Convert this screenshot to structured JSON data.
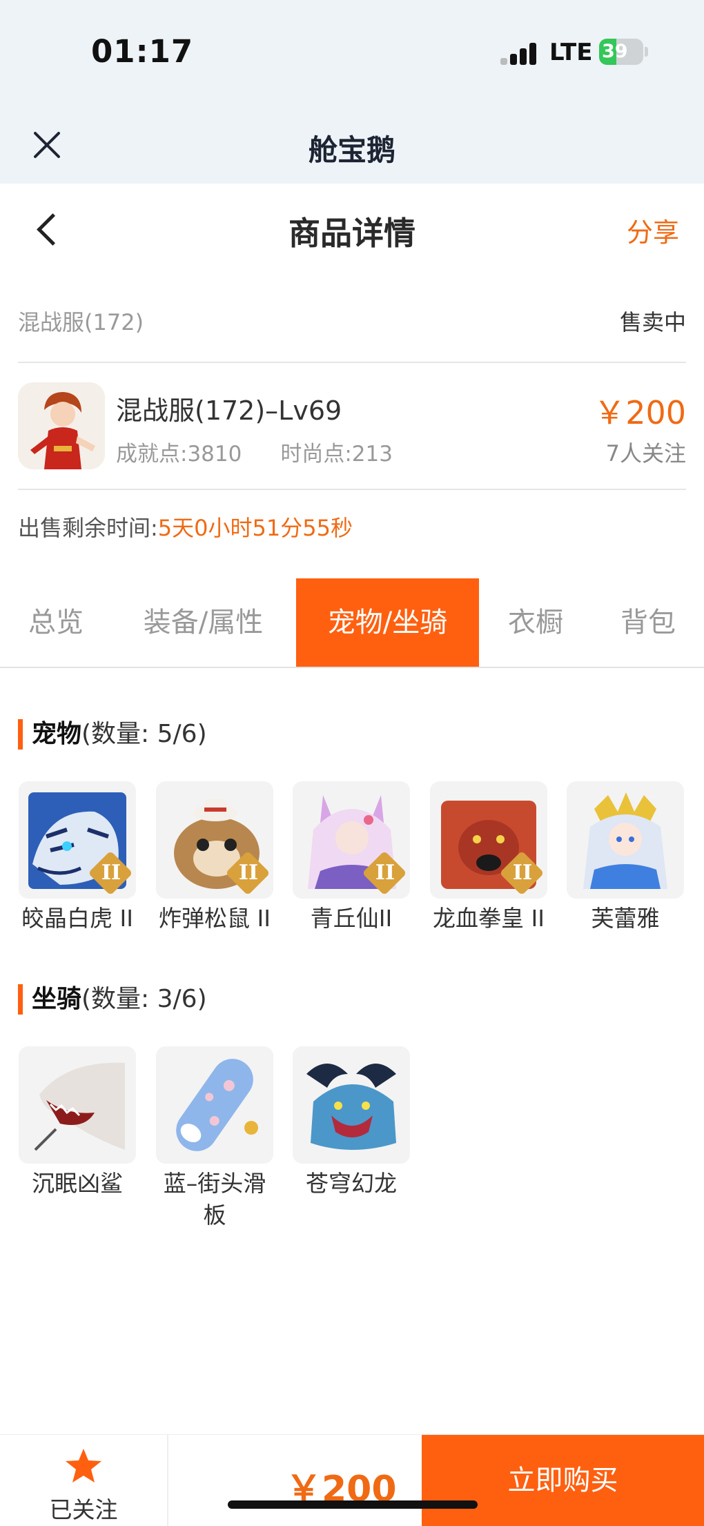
{
  "status_bar": {
    "time": "01:17",
    "network": "LTE",
    "battery": "39",
    "battery_level": 0.39
  },
  "app_bar": {
    "title": "舱宝鹅"
  },
  "nav": {
    "title": "商品详情",
    "share": "分享"
  },
  "listing": {
    "server": "混战服(172)",
    "status": "售卖中",
    "name": "混战服(172)–Lv69",
    "achievement": "成就点:3810",
    "fashion": "时尚点:213",
    "price": "￥200",
    "followers": "7人关注",
    "remaining_label": "出售剩余时间:",
    "remaining_value": "5天0小时51分55秒"
  },
  "tabs": [
    {
      "label": "总览",
      "active": false
    },
    {
      "label": "装备/属性",
      "active": false
    },
    {
      "label": "宠物/坐骑",
      "active": true
    },
    {
      "label": "衣橱",
      "active": false
    },
    {
      "label": "背包",
      "active": false
    }
  ],
  "pets": {
    "title": "宠物",
    "count": "(数量: 5/6)",
    "items": [
      {
        "name": "皎晶白虎 II",
        "badge": "II"
      },
      {
        "name": "炸弹松鼠 II",
        "badge": "II"
      },
      {
        "name": "青丘仙II",
        "badge": "II"
      },
      {
        "name": "龙血拳皇 II",
        "badge": "II"
      },
      {
        "name": "芙蕾雅",
        "badge": ""
      }
    ]
  },
  "mounts": {
    "title": "坐骑",
    "count": "(数量: 3/6)",
    "items": [
      {
        "name": "沉眠凶鲨"
      },
      {
        "name": "蓝–街头滑板"
      },
      {
        "name": "苍穹幻龙"
      }
    ]
  },
  "bottom_bar": {
    "follow_label": "已关注",
    "price": "￥200",
    "buy_label": "立即购买"
  },
  "colors": {
    "accent": "#ff6010",
    "price": "#f06a14",
    "header_bg": "#eef3f7"
  }
}
